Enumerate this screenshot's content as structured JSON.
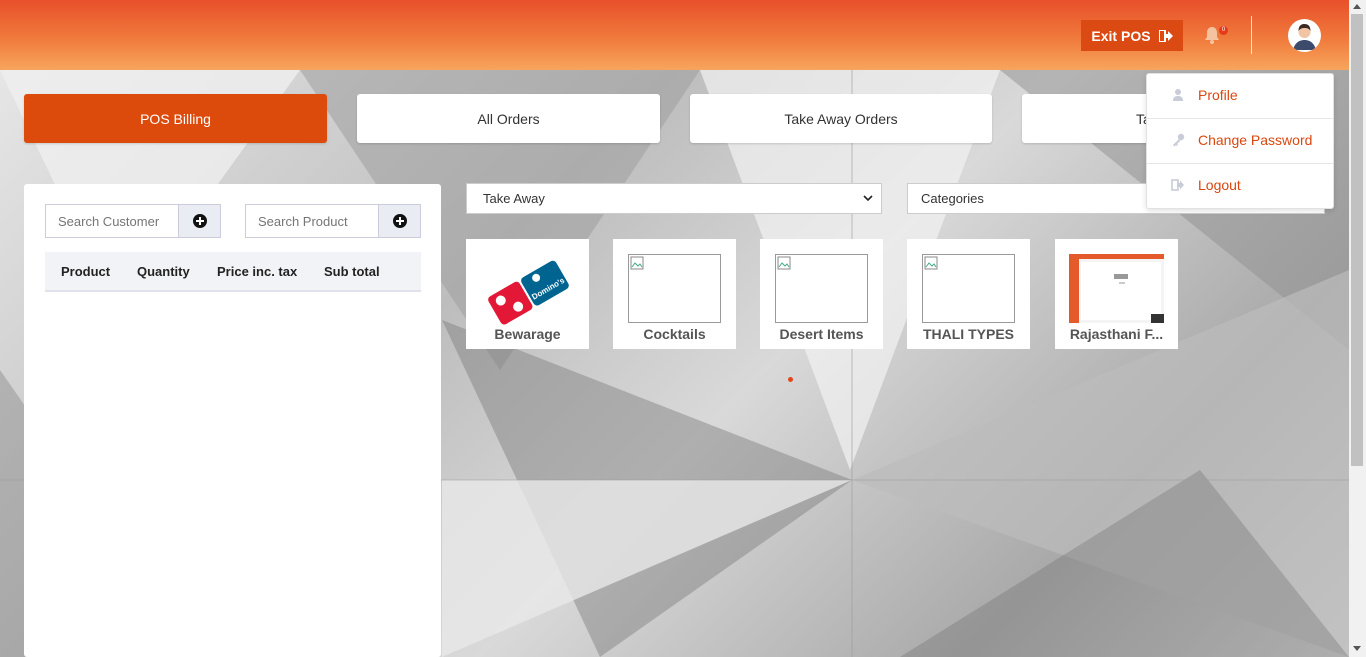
{
  "header": {
    "exit_label": "Exit POS",
    "notification_count": "0"
  },
  "tabs": [
    {
      "label": "POS Billing",
      "active": true
    },
    {
      "label": "All Orders",
      "active": false
    },
    {
      "label": "Take Away Orders",
      "active": false
    },
    {
      "label": "Ta",
      "active": false
    }
  ],
  "left_panel": {
    "customer_search_placeholder": "Search Customer",
    "product_search_placeholder": "Search Product",
    "columns": [
      "Product",
      "Quantity",
      "Price inc. tax",
      "Sub total"
    ]
  },
  "filters": {
    "order_type_selected": "Take Away",
    "category_selected": "Categories"
  },
  "categories": [
    {
      "label": "Bewarage",
      "image": "dominos-logo"
    },
    {
      "label": "Cocktails",
      "image": "broken-image"
    },
    {
      "label": "Desert Items",
      "image": "broken-image"
    },
    {
      "label": "THALI TYPES",
      "image": "broken-image"
    },
    {
      "label": "Rajasthani F...",
      "image": "page-screenshot"
    }
  ],
  "user_menu": {
    "items": [
      {
        "label": "Profile",
        "icon": "user-icon"
      },
      {
        "label": "Change Password",
        "icon": "key-icon"
      },
      {
        "label": "Logout",
        "icon": "logout-icon"
      }
    ]
  },
  "colors": {
    "accent": "#dc4a0c",
    "menu_text": "#d9480f",
    "header_top": "#e8502a",
    "header_bottom": "#f7a55c"
  }
}
